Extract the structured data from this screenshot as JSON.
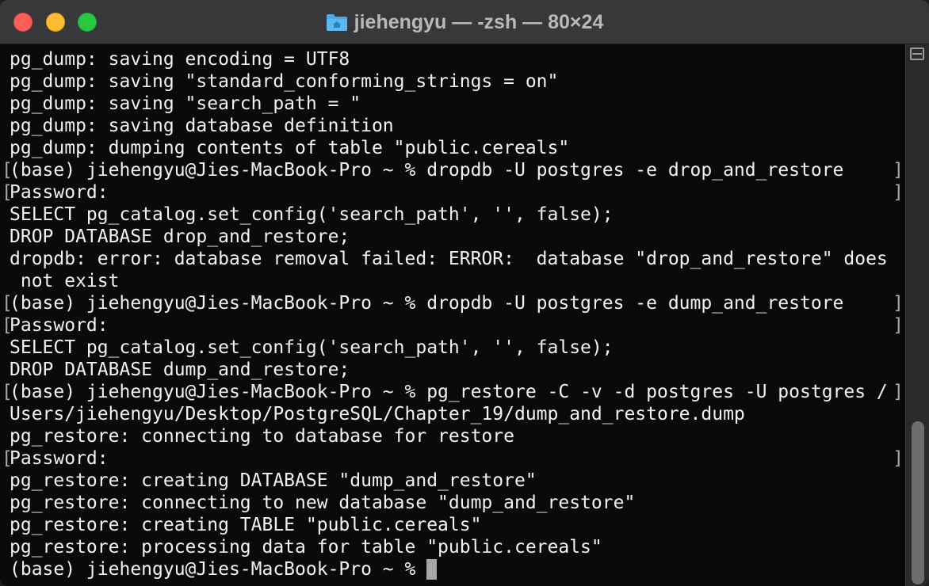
{
  "window": {
    "title": "jiehengyu — -zsh — 80×24",
    "folder_icon_color": "#4aa7e8"
  },
  "colors": {
    "terminal_bg": "#0a0a0a",
    "terminal_fg": "#f2f2f2",
    "titlebar_bg": "#38373a"
  },
  "terminal": {
    "lines": [
      {
        "text": "pg_dump: saving encoding = UTF8",
        "marked": false
      },
      {
        "text": "pg_dump: saving \"standard_conforming_strings = on\"",
        "marked": false
      },
      {
        "text": "pg_dump: saving \"search_path = \"",
        "marked": false
      },
      {
        "text": "pg_dump: saving database definition",
        "marked": false
      },
      {
        "text": "pg_dump: dumping contents of table \"public.cereals\"",
        "marked": false
      },
      {
        "text": "(base) jiehengyu@Jies-MacBook-Pro ~ % dropdb -U postgres -e drop_and_restore",
        "marked": true
      },
      {
        "text": "Password:",
        "marked": true
      },
      {
        "text": "SELECT pg_catalog.set_config('search_path', '', false);",
        "marked": false
      },
      {
        "text": "DROP DATABASE drop_and_restore;",
        "marked": false
      },
      {
        "text": "dropdb: error: database removal failed: ERROR:  database \"drop_and_restore\" does",
        "marked": false
      },
      {
        "text": " not exist",
        "marked": false
      },
      {
        "text": "(base) jiehengyu@Jies-MacBook-Pro ~ % dropdb -U postgres -e dump_and_restore",
        "marked": true
      },
      {
        "text": "Password:",
        "marked": true
      },
      {
        "text": "SELECT pg_catalog.set_config('search_path', '', false);",
        "marked": false
      },
      {
        "text": "DROP DATABASE dump_and_restore;",
        "marked": false
      },
      {
        "text": "(base) jiehengyu@Jies-MacBook-Pro ~ % pg_restore -C -v -d postgres -U postgres /",
        "marked": true
      },
      {
        "text": "Users/jiehengyu/Desktop/PostgreSQL/Chapter_19/dump_and_restore.dump",
        "marked": false
      },
      {
        "text": "pg_restore: connecting to database for restore",
        "marked": false
      },
      {
        "text": "Password:",
        "marked": true
      },
      {
        "text": "pg_restore: creating DATABASE \"dump_and_restore\"",
        "marked": false
      },
      {
        "text": "pg_restore: connecting to new database \"dump_and_restore\"",
        "marked": false
      },
      {
        "text": "pg_restore: creating TABLE \"public.cereals\"",
        "marked": false
      },
      {
        "text": "pg_restore: processing data for table \"public.cereals\"",
        "marked": false
      }
    ],
    "prompt": "(base) jiehengyu@Jies-MacBook-Pro ~ % "
  }
}
